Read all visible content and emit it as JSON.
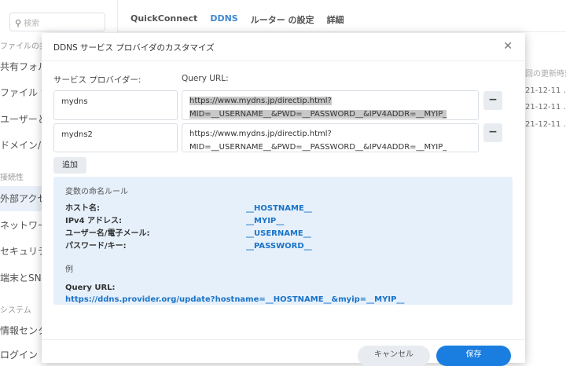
{
  "sidebar": {
    "search_placeholder": "検索",
    "items": [
      {
        "label": "ファイルの共",
        "type": "header"
      },
      {
        "label": "共有フォル",
        "type": "item"
      },
      {
        "label": "ファイル サ",
        "type": "item"
      },
      {
        "label": "ユーザーと",
        "type": "item"
      },
      {
        "label": "ドメイン/L",
        "type": "item"
      },
      {
        "label": "接続性",
        "type": "header"
      },
      {
        "label": "外部アクセ",
        "type": "item",
        "selected": true
      },
      {
        "label": "ネットワー",
        "type": "item"
      },
      {
        "label": "セキュリテ",
        "type": "item"
      },
      {
        "label": "端末とSNM",
        "type": "item"
      },
      {
        "label": "システム",
        "type": "header"
      },
      {
        "label": "情報センタ",
        "type": "item"
      },
      {
        "label": "ログイン",
        "type": "item"
      }
    ]
  },
  "tabs": [
    {
      "label": "QuickConnect",
      "active": false
    },
    {
      "label": "DDNS",
      "active": true
    },
    {
      "label": "ルーター の設定",
      "active": false
    },
    {
      "label": "詳細",
      "active": false
    }
  ],
  "background_table": {
    "header": "回の更新時刻",
    "rows": [
      "21-12-11 .",
      "21-12-11 .",
      "21-12-11 ."
    ]
  },
  "modal": {
    "title": "DDNS サービス プロバイダのカスタマイズ",
    "close_icon": "close-icon",
    "provider_label": "サービス プロバイダー:",
    "url_label": "Query URL:",
    "providers": [
      {
        "name": "mydns",
        "url_line1": "https://www.mydns.jp/directip.html?",
        "url_line2": "MID=__USERNAME__&PWD=__PASSWORD__&IPV4ADDR=__MYIP_",
        "selected": true
      },
      {
        "name": "mydns2",
        "url_line1": "https://www.mydns.jp/directip.html?",
        "url_line2": "MID=__USERNAME__&PWD=__PASSWORD__&IPV4ADDR=__MYIP_",
        "selected": false
      }
    ],
    "remove_label": "−",
    "add_label": "追加",
    "info": {
      "title": "変数の命名ルール",
      "vars": [
        {
          "key": "ホスト名:",
          "value": "__HOSTNAME__"
        },
        {
          "key": "IPv4 アドレス:",
          "value": "__MYIP__"
        },
        {
          "key": "ユーザー名/電子メール:",
          "value": "__USERNAME__"
        },
        {
          "key": "パスワード/キー:",
          "value": "__PASSWORD__"
        }
      ],
      "example_label": "例",
      "query_label": "Query URL:",
      "query_example": "https://ddns.provider.org/update?hostname=__HOSTNAME__&myip=__MYIP__"
    },
    "cancel_label": "キャンセル",
    "save_label": "保存"
  },
  "colors": {
    "accent": "#1a7ee0",
    "info_bg": "#e6f0fb"
  }
}
